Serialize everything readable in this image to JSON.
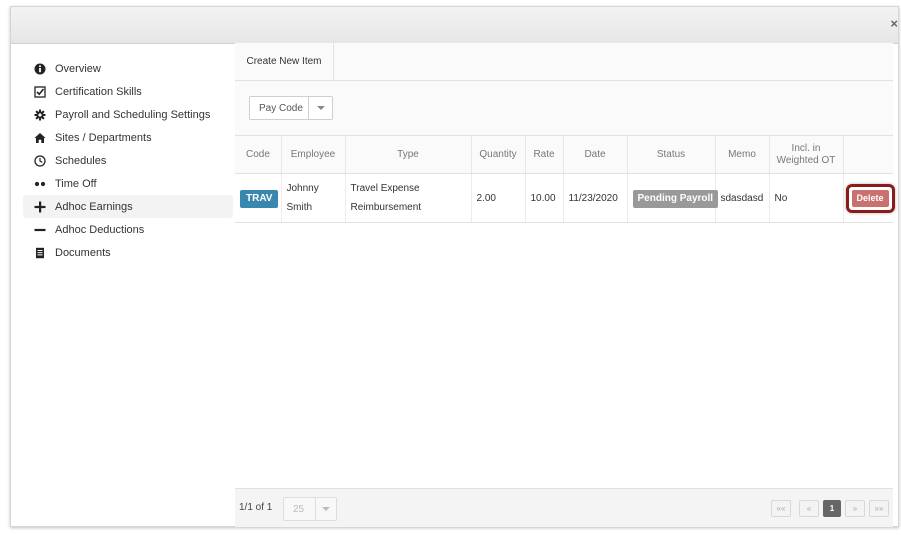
{
  "window": {
    "close_glyph": "×"
  },
  "sidebar": {
    "items": [
      {
        "label": "Overview",
        "icon": "info-icon"
      },
      {
        "label": "Certification Skills",
        "icon": "checkbox-icon"
      },
      {
        "label": "Payroll and Scheduling Settings",
        "icon": "gear-icon"
      },
      {
        "label": "Sites / Departments",
        "icon": "home-icon"
      },
      {
        "label": "Schedules",
        "icon": "clock-icon"
      },
      {
        "label": "Time Off",
        "icon": "dots-icon"
      },
      {
        "label": "Adhoc Earnings",
        "icon": "plus-icon",
        "active": true
      },
      {
        "label": "Adhoc Deductions",
        "icon": "minus-icon"
      },
      {
        "label": "Documents",
        "icon": "document-icon"
      }
    ]
  },
  "toolbar": {
    "create_label": "Create New Item"
  },
  "filter": {
    "paycode_label": "Pay Code"
  },
  "table": {
    "headers": [
      "Code",
      "Employee",
      "Type",
      "Quantity",
      "Rate",
      "Date",
      "Status",
      "Memo",
      "Incl. in Weighted OT",
      ""
    ],
    "rows": [
      {
        "code": "TRAV",
        "employee_first": "Johnny",
        "employee_last": "Smith",
        "type_line1": "Travel Expense",
        "type_line2": "Reimbursement",
        "quantity": "2.00",
        "rate": "10.00",
        "date": "11/23/2020",
        "status": "Pending Payroll",
        "memo": "sdasdasd",
        "weighted_ot": "No",
        "action": "Delete"
      }
    ]
  },
  "footer": {
    "page_info": "1/1 of 1",
    "page_size": "25",
    "pager": {
      "first": "««",
      "prev": "«",
      "current": "1",
      "next": "»",
      "last": "»»"
    }
  },
  "colors": {
    "code_badge": "#3a87ad",
    "status_badge": "#999999",
    "delete_button": "#c9716f",
    "highlight_ring": "#8b1a1a"
  }
}
